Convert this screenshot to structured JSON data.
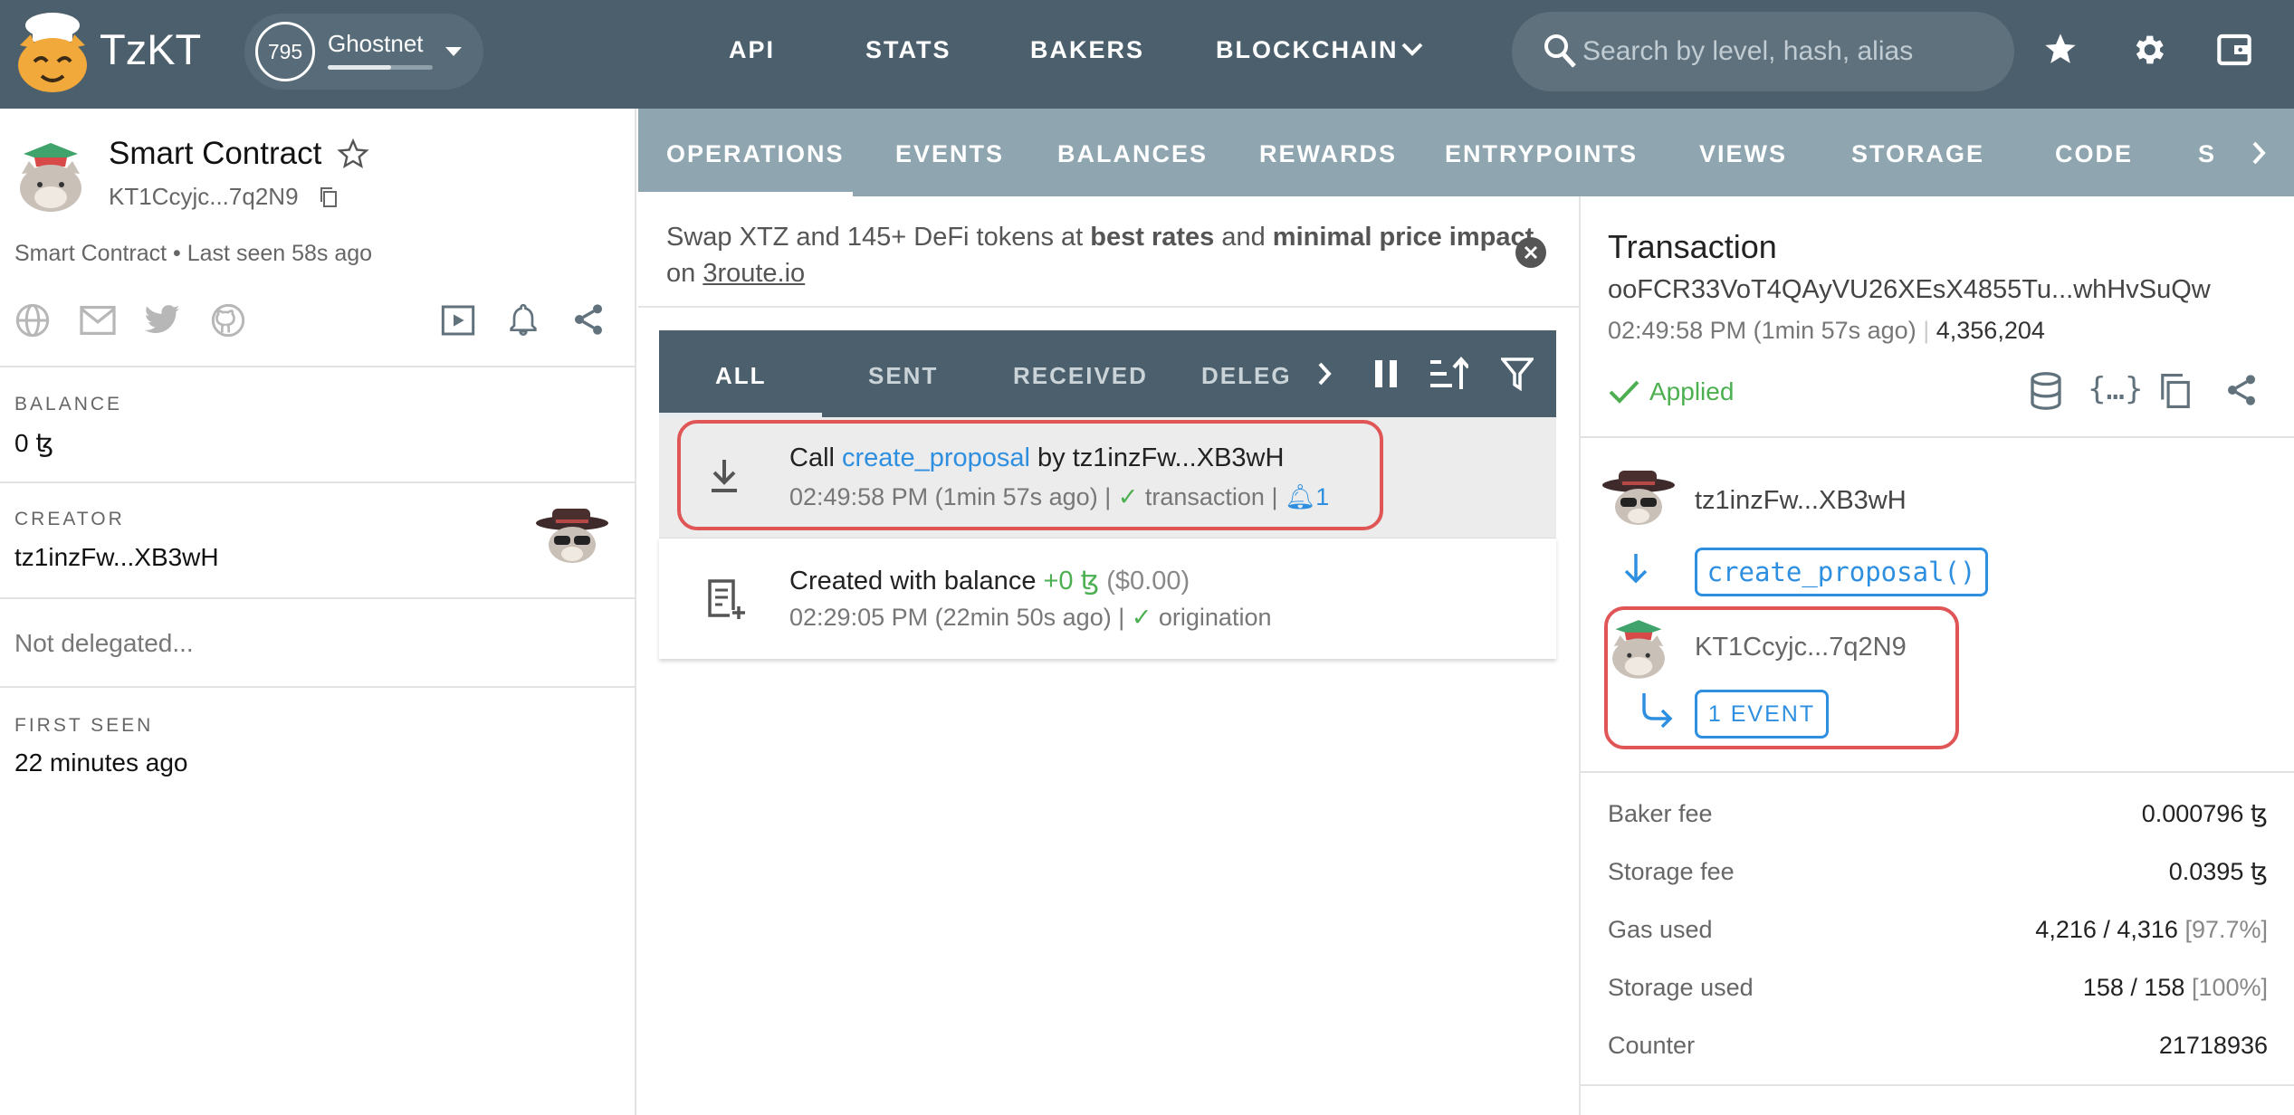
{
  "header": {
    "logo_text": "TzKT",
    "network": {
      "level": "795",
      "name": "Ghostnet",
      "progress": 0.6
    },
    "nav": [
      "API",
      "STATS",
      "BAKERS",
      "BLOCKCHAIN"
    ],
    "search_placeholder": "Search by level, hash, alias"
  },
  "left": {
    "title": "Smart Contract",
    "address": "KT1Ccyjc...7q2N9",
    "subtitle": "Smart Contract • Last seen 58s ago",
    "balance_label": "BALANCE",
    "balance_value": "0 ꜩ",
    "creator_label": "CREATOR",
    "creator_value": "tz1inzFw...XB3wH",
    "delegation": "Not delegated...",
    "first_seen_label": "FIRST SEEN",
    "first_seen_value": "22 minutes ago"
  },
  "tabs": [
    "OPERATIONS",
    "EVENTS",
    "BALANCES",
    "REWARDS",
    "ENTRYPOINTS",
    "VIEWS",
    "STORAGE",
    "CODE",
    "S"
  ],
  "promo": {
    "p1": "Swap XTZ and 145+ DeFi tokens at ",
    "b1": "best rates",
    "p2": " and ",
    "b2": "minimal price impact",
    "p3": " on ",
    "link": "3route.io"
  },
  "subtabs": [
    "ALL",
    "SENT",
    "RECEIVED",
    "DELEG"
  ],
  "operations": [
    {
      "prefix": "Call ",
      "entrypoint": "create_proposal",
      "by": " by tz1inzFw...XB3wH",
      "time": "02:49:58 PM (1min 57s ago) |",
      "type": "transaction",
      "sep": "|",
      "events": "1"
    },
    {
      "prefix": "Created with balance ",
      "amount": "+0 ꜩ",
      "usd": " ($0.00)",
      "time": "02:29:05 PM (22min 50s ago) |",
      "type": "origination"
    }
  ],
  "detail": {
    "title": "Transaction",
    "hash": "ooFCR33VoT4QAyVU26XEsX4855Tu...whHvSuQw",
    "time": "02:49:58 PM (1min 57s ago)",
    "level": "4,356,204",
    "status": "Applied",
    "sender": "tz1inzFw...XB3wH",
    "entrypoint_call": "create_proposal()",
    "target": "KT1Ccyjc...7q2N9",
    "events_button": "1 EVENT",
    "rows": [
      {
        "label": "Baker fee",
        "value": "0.000796 ꜩ",
        "extra": ""
      },
      {
        "label": "Storage fee",
        "value": "0.0395 ꜩ",
        "extra": ""
      },
      {
        "label": "Gas used",
        "value": "4,216 / 4,316 ",
        "extra": "[97.7%]"
      },
      {
        "label": "Storage used",
        "value": "158 / 158 ",
        "extra": "[100%]"
      },
      {
        "label": "Counter",
        "value": "21718936",
        "extra": ""
      }
    ]
  },
  "colors": {
    "topbar": "#4c5f6c",
    "tabbar": "#8fa6b0",
    "accent": "#2e8fe0",
    "success": "#4caf50",
    "highlight": "#e05656"
  }
}
